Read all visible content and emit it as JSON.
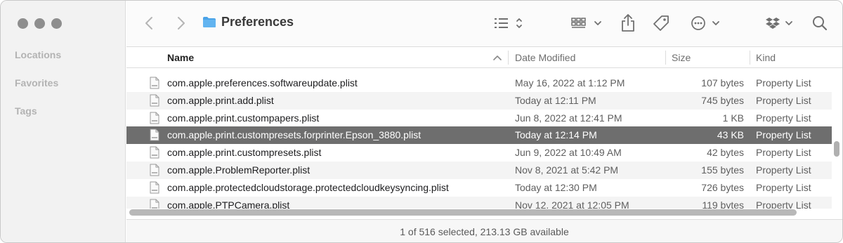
{
  "sidebar": {
    "sections": [
      "Locations",
      "Favorites",
      "Tags"
    ]
  },
  "toolbar": {
    "title": "Preferences",
    "icons": [
      "back-chevron-icon",
      "forward-chevron-icon",
      "folder-icon",
      "list-view-icon",
      "group-by-icon",
      "share-icon",
      "tag-icon",
      "more-actions-icon",
      "dropbox-icon",
      "search-icon"
    ]
  },
  "columns": {
    "name": "Name",
    "date": "Date Modified",
    "size": "Size",
    "kind": "Kind"
  },
  "rows": [
    {
      "name": "com.apple.preferences.softwareupdate.plist",
      "date": "May 16, 2022 at 1:12 PM",
      "size": "107 bytes",
      "kind": "Property List",
      "selected": false
    },
    {
      "name": "com.apple.print.add.plist",
      "date": "Today at 12:11 PM",
      "size": "745 bytes",
      "kind": "Property List",
      "selected": false
    },
    {
      "name": "com.apple.print.custompapers.plist",
      "date": "Jun 8, 2022 at 12:41 PM",
      "size": "1 KB",
      "kind": "Property List",
      "selected": false
    },
    {
      "name": "com.apple.print.custompresets.forprinter.Epson_3880.plist",
      "date": "Today at 12:14 PM",
      "size": "43 KB",
      "kind": "Property List",
      "selected": true
    },
    {
      "name": "com.apple.print.custompresets.plist",
      "date": "Jun 9, 2022 at 10:49 AM",
      "size": "42 bytes",
      "kind": "Property List",
      "selected": false
    },
    {
      "name": "com.apple.ProblemReporter.plist",
      "date": "Nov 8, 2021 at 5:42 PM",
      "size": "155 bytes",
      "kind": "Property List",
      "selected": false
    },
    {
      "name": "com.apple.protectedcloudstorage.protectedcloudkeysyncing.plist",
      "date": "Today at 12:30 PM",
      "size": "726 bytes",
      "kind": "Property List",
      "selected": false
    },
    {
      "name": "com.apple.PTPCamera.plist",
      "date": "Nov 12, 2021 at 12:05 PM",
      "size": "119 bytes",
      "kind": "Property List",
      "selected": false
    }
  ],
  "status": {
    "text": "1 of 516 selected, 213.13 GB available"
  },
  "colors": {
    "selected_row": "#6e6e6e",
    "traffic_light": "#8e8e8e"
  }
}
